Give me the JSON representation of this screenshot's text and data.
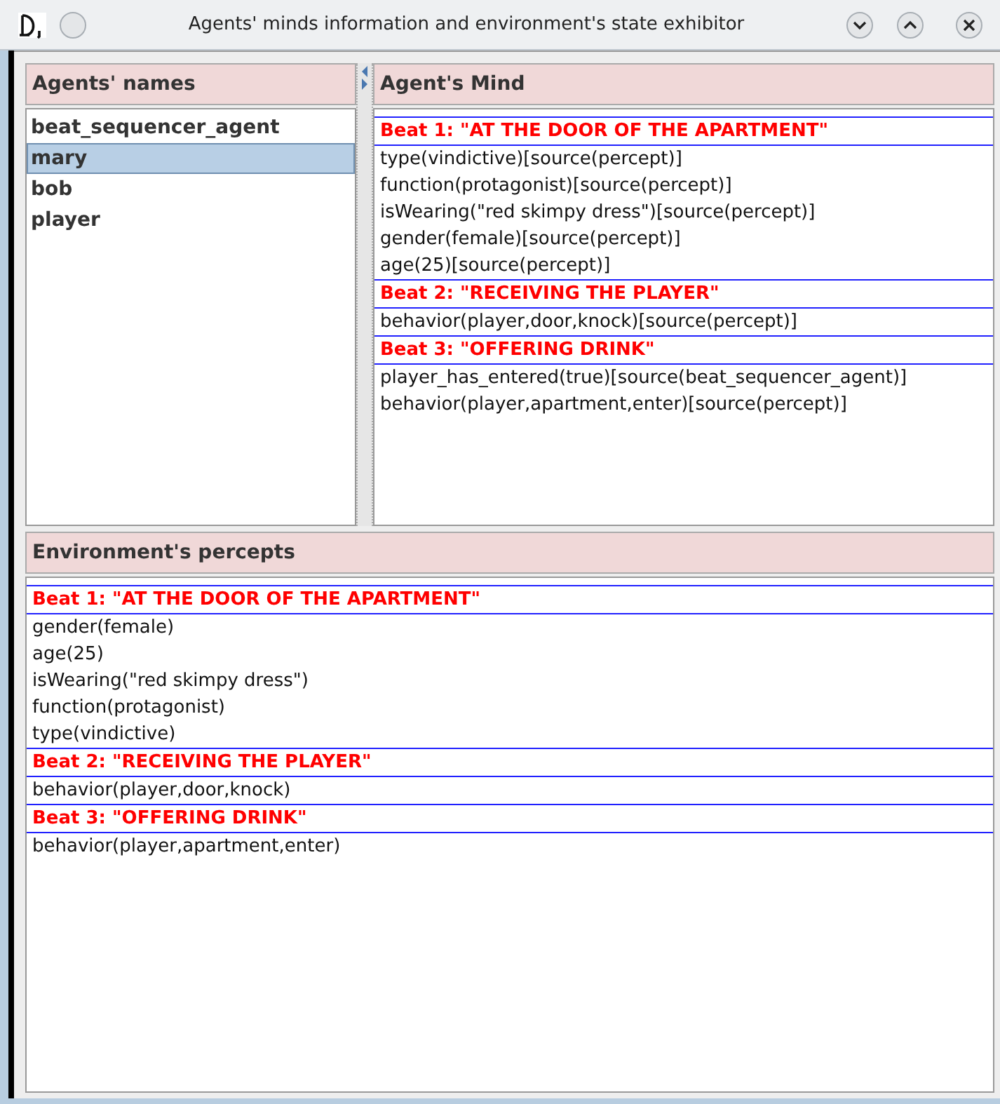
{
  "window": {
    "title": "Agents' minds information and environment's state exhibitor"
  },
  "agents_names": {
    "header": "Agents' names",
    "items": [
      {
        "label": "beat_sequencer_agent",
        "selected": false
      },
      {
        "label": "mary",
        "selected": true
      },
      {
        "label": "bob",
        "selected": false
      },
      {
        "label": "player",
        "selected": false
      }
    ]
  },
  "agents_mind": {
    "header": "Agent's Mind",
    "beats": [
      {
        "title": "Beat 1: \"AT THE DOOR OF THE APARTMENT\"",
        "items": [
          "type(vindictive)[source(percept)]",
          "function(protagonist)[source(percept)]",
          "isWearing(\"red skimpy dress\")[source(percept)]",
          "gender(female)[source(percept)]",
          "age(25)[source(percept)]"
        ]
      },
      {
        "title": "Beat 2: \"RECEIVING THE PLAYER\"",
        "items": [
          "behavior(player,door,knock)[source(percept)]"
        ]
      },
      {
        "title": "Beat 3: \"OFFERING DRINK\"",
        "items": [
          "player_has_entered(true)[source(beat_sequencer_agent)]",
          "behavior(player,apartment,enter)[source(percept)]"
        ]
      }
    ]
  },
  "environment_percepts": {
    "header": "Environment's percepts",
    "beats": [
      {
        "title": "Beat 1: \"AT THE DOOR OF THE APARTMENT\"",
        "items": [
          "gender(female)",
          "age(25)",
          "isWearing(\"red skimpy dress\")",
          "function(protagonist)",
          "type(vindictive)"
        ]
      },
      {
        "title": "Beat 2: \"RECEIVING THE PLAYER\"",
        "items": [
          "behavior(player,door,knock)"
        ]
      },
      {
        "title": "Beat 3: \"OFFERING DRINK\"",
        "items": [
          "behavior(player,apartment,enter)"
        ]
      }
    ]
  }
}
